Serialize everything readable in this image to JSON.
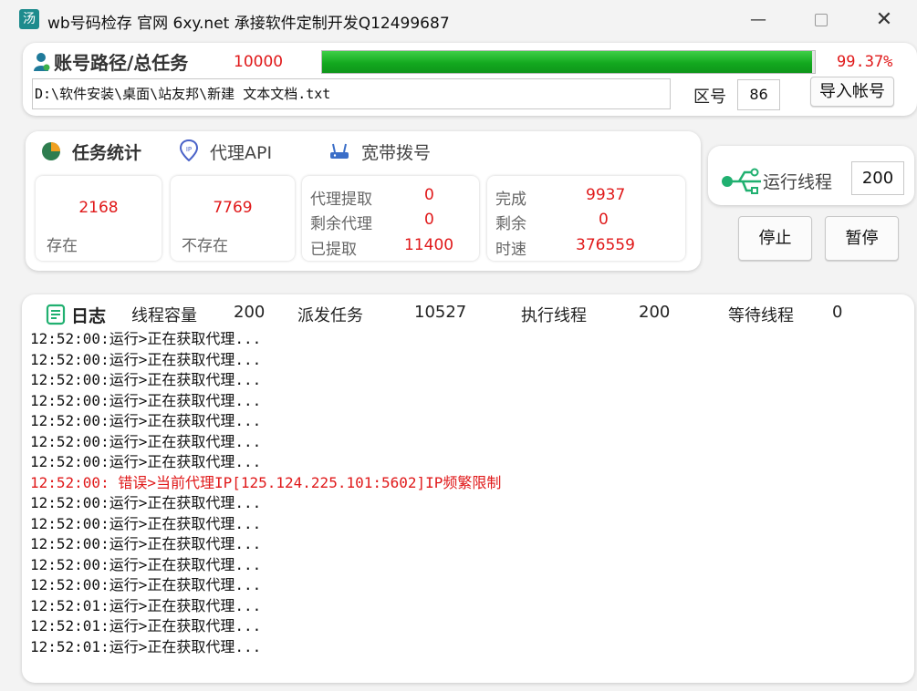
{
  "window": {
    "title": "wb号码检存  官网 6xy.net  承接软件定制开发Q12499687",
    "icon_name": "app-logo-icon",
    "min_label": "—",
    "close_label": "✕"
  },
  "account": {
    "label": "账号路径/总任务",
    "total": "10000",
    "progress": 0.9937,
    "progress_text": "99.37%",
    "path": "D:\\软件安装\\桌面\\站友邦\\新建 文本文档.txt",
    "area_label": "区号",
    "area_value": "86",
    "import_button": "导入帐号"
  },
  "tabs": [
    {
      "label": "任务统计",
      "icon": "pie-chart-icon"
    },
    {
      "label": "代理API",
      "icon": "ip-location-icon"
    },
    {
      "label": "宽带拨号",
      "icon": "router-icon"
    }
  ],
  "stats": {
    "exist_value": "2168",
    "exist_label": "存在",
    "not_exist_value": "7769",
    "not_exist_label": "不存在",
    "proxy": [
      {
        "label": "代理提取",
        "value": "0"
      },
      {
        "label": "剩余代理",
        "value": "0"
      },
      {
        "label": "已提取",
        "value": "11400"
      }
    ],
    "progress": [
      {
        "label": "完成",
        "value": "9937"
      },
      {
        "label": "剩余",
        "value": "0"
      },
      {
        "label": "时速",
        "value": "376559"
      }
    ]
  },
  "thread": {
    "label": "运行线程",
    "value": "200",
    "stop_button": "停止",
    "pause_button": "暂停"
  },
  "log": {
    "title": "日志",
    "capacity_label": "线程容量",
    "capacity_value": "200",
    "dispatched_label": "派发任务",
    "dispatched_value": "10527",
    "running_label": "执行线程",
    "running_value": "200",
    "waiting_label": "等待线程",
    "waiting_value": "0",
    "lines": [
      {
        "text": "12:52:00:运行>正在获取代理...",
        "error": false
      },
      {
        "text": "12:52:00:运行>正在获取代理...",
        "error": false
      },
      {
        "text": "12:52:00:运行>正在获取代理...",
        "error": false
      },
      {
        "text": "12:52:00:运行>正在获取代理...",
        "error": false
      },
      {
        "text": "12:52:00:运行>正在获取代理...",
        "error": false
      },
      {
        "text": "12:52:00:运行>正在获取代理...",
        "error": false
      },
      {
        "text": "12:52:00:运行>正在获取代理...",
        "error": false
      },
      {
        "text": "12:52:00: 错误>当前代理IP[125.124.225.101:5602]IP频繁限制",
        "error": true
      },
      {
        "text": "12:52:00:运行>正在获取代理...",
        "error": false
      },
      {
        "text": "12:52:00:运行>正在获取代理...",
        "error": false
      },
      {
        "text": "12:52:00:运行>正在获取代理...",
        "error": false
      },
      {
        "text": "12:52:00:运行>正在获取代理...",
        "error": false
      },
      {
        "text": "12:52:00:运行>正在获取代理...",
        "error": false
      },
      {
        "text": "12:52:01:运行>正在获取代理...",
        "error": false
      },
      {
        "text": "12:52:01:运行>正在获取代理...",
        "error": false
      },
      {
        "text": "12:52:01:运行>正在获取代理...",
        "error": false
      }
    ]
  },
  "colors": {
    "accent_red": "#e0191a",
    "progress_green": "#13a91f",
    "log_icon_green": "#20b070"
  }
}
